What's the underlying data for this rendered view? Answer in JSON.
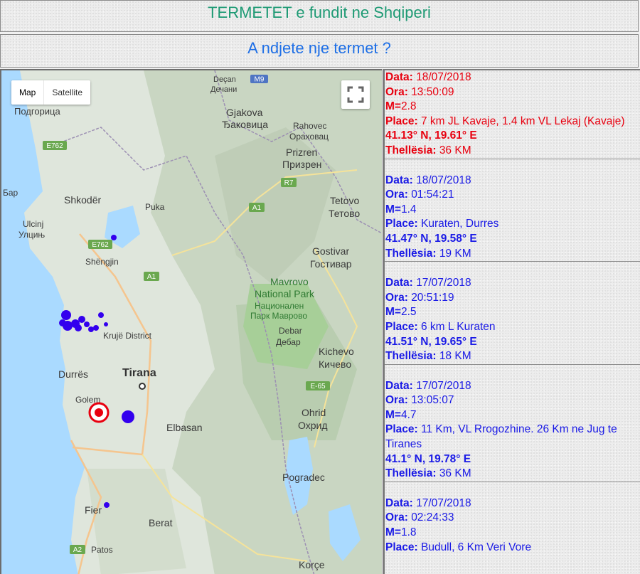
{
  "header": {
    "title": "TERMETET e fundit ne Shqiperi",
    "subtitle": "A ndjete nje termet ?"
  },
  "colors": {
    "title": "#1e9a74",
    "subtitle": "#1e6fe6",
    "latest_quake": "#e8000f",
    "quake": "#1a1ae6",
    "marker": "#3300ee"
  },
  "map": {
    "controls": {
      "map_label": "Map",
      "satellite_label": "Satellite",
      "fullscreen_icon": "fullscreen-icon"
    },
    "labels": {
      "desan": "Deçan",
      "desan_cyr": "Дечани",
      "m9": "M9",
      "podgorica": "Подгорица",
      "gjakova": "Gjakova",
      "gjakova_cyr": "Ђаковица",
      "rahovec": "Rahovec",
      "rahovec_cyr": "Ораховац",
      "e762a": "E762",
      "prizren": "Prizren",
      "prizren_cyr": "Призрен",
      "bar": "Бар",
      "r7": "R7",
      "shkoder": "Shkodër",
      "puka": "Puka",
      "a1a": "A1",
      "tetovo": "Tetovo",
      "tetovo_cyr": "Тетово",
      "ulcinj": "Ulcinj",
      "ulcinj_cyr": "Улцињ",
      "e762b": "E762",
      "gostivar": "Gostivar",
      "gostivar_cyr": "Гостивар",
      "shengjin": "Shëngjin",
      "a1b": "A1",
      "mavrovo1": "Mavrovo",
      "mavrovo2": "National Park",
      "mavrovo_cyr1": "Национален",
      "mavrovo_cyr2": "Парк Маврово",
      "kruje": "Krujë District",
      "debar": "Debar",
      "debar_cyr": "Дебар",
      "kichevo": "Kichevo",
      "kichevo_cyr": "Кичево",
      "durres": "Durrës",
      "tirana": "Tirana",
      "e65": "E-65",
      "golem": "Golem",
      "ohrid": "Ohrid",
      "ohrid_cyr": "Охрид",
      "elbasan": "Elbasan",
      "pogradec": "Pogradec",
      "fier": "Fier",
      "berat": "Berat",
      "patos": "Patos",
      "a2": "A2",
      "korce": "Korçe"
    }
  },
  "labels": {
    "date": "Data:",
    "time": "Ora:",
    "magnitude": "M=",
    "place": "Place:",
    "depth": "Thellësia:"
  },
  "quakes": [
    {
      "date": "18/07/2018",
      "time": "13:50:09",
      "magnitude": "2.8",
      "place": "7 km JL Kavaje, 1.4 km VL Lekaj (Kavaje)",
      "coords": "41.13° N, 19.61° E",
      "depth": "36 KM",
      "latest": true
    },
    {
      "date": "18/07/2018",
      "time": "01:54:21",
      "magnitude": "1.4",
      "place": "Kuraten, Durres",
      "coords": "41.47° N, 19.58° E",
      "depth": "19 KM"
    },
    {
      "date": "17/07/2018",
      "time": "20:51:19",
      "magnitude": "2.5",
      "place": "6 km L Kuraten",
      "coords": "41.51° N, 19.65° E",
      "depth": "18 KM"
    },
    {
      "date": "17/07/2018",
      "time": "13:05:07",
      "magnitude": "4.7",
      "place": "11 Km, VL Rrogozhine. 26 Km ne Jug te Tiranes",
      "coords": "41.1° N, 19.78° E",
      "depth": "36 KM"
    },
    {
      "date": "17/07/2018",
      "time": "02:24:33",
      "magnitude": "1.8",
      "place": "Budull, 6 Km Veri Vore",
      "coords": "",
      "depth": ""
    }
  ]
}
